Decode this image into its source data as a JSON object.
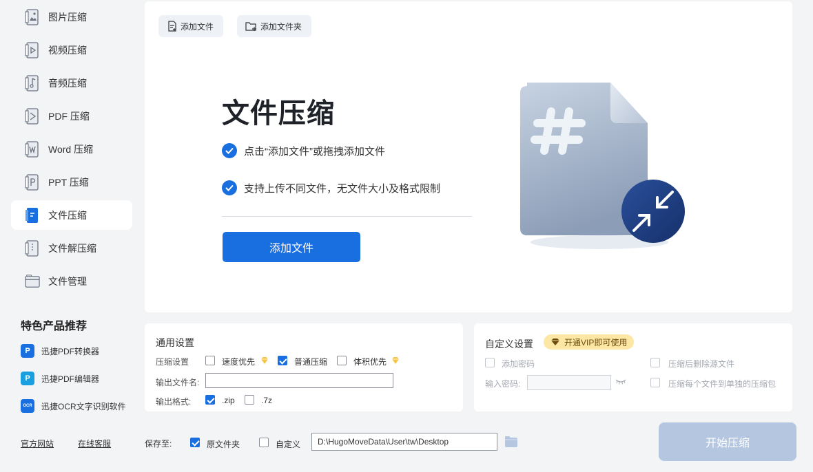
{
  "sidebar": {
    "items": [
      {
        "label": "图片压缩",
        "icon": "image-compress-icon"
      },
      {
        "label": "视频压缩",
        "icon": "video-compress-icon"
      },
      {
        "label": "音频压缩",
        "icon": "audio-compress-icon"
      },
      {
        "label": "PDF 压缩",
        "icon": "pdf-compress-icon"
      },
      {
        "label": "Word 压缩",
        "icon": "word-compress-icon"
      },
      {
        "label": "PPT 压缩",
        "icon": "ppt-compress-icon"
      },
      {
        "label": "文件压缩",
        "icon": "file-compress-icon",
        "active": true
      },
      {
        "label": "文件解压缩",
        "icon": "file-decompress-icon"
      },
      {
        "label": "文件管理",
        "icon": "file-manage-icon"
      }
    ],
    "promo_title": "特色产品推荐",
    "promos": [
      {
        "label": "迅捷PDF转换器",
        "icon": "pdf-converter-icon",
        "glyph": "P",
        "color": "#1a6fe0"
      },
      {
        "label": "迅捷PDF编辑器",
        "icon": "pdf-editor-icon",
        "glyph": "P",
        "color": "#1aa0e0"
      },
      {
        "label": "迅捷OCR文字识别软件",
        "icon": "ocr-icon",
        "glyph": "OCR",
        "color": "#1a6fe0"
      }
    ],
    "footer": {
      "website": "官方网站",
      "support": "在线客服"
    }
  },
  "main": {
    "add_file_btn": "添加文件",
    "add_folder_btn": "添加文件夹",
    "title": "文件压缩",
    "features": [
      "点击“添加文件”或拖拽添加文件",
      "支持上传不同文件，无文件大小及格式限制"
    ],
    "cta": "添加文件",
    "accent": "#1a6fe0"
  },
  "general_settings": {
    "title": "通用设置",
    "compress_label": "压缩设置",
    "options": [
      {
        "label": "速度优先",
        "checked": false,
        "vip": true
      },
      {
        "label": "普通压缩",
        "checked": true,
        "vip": false
      },
      {
        "label": "体积优先",
        "checked": false,
        "vip": true
      }
    ],
    "output_name_label": "输出文件名:",
    "output_name_value": "",
    "format_label": "输出格式:",
    "formats": [
      {
        "label": ".zip",
        "checked": true
      },
      {
        "label": ".7z",
        "checked": false
      }
    ]
  },
  "custom_settings": {
    "title": "自定义设置",
    "vip_badge": "开通VIP即可使用",
    "add_password": "添加密码",
    "password_label": "输入密码:",
    "password_value": "",
    "delete_source": "压缩后删除源文件",
    "separate_archives": "压缩每个文件到单独的压缩包"
  },
  "save": {
    "label": "保存至:",
    "original_folder": "原文件夹",
    "original_checked": true,
    "custom": "自定义",
    "custom_checked": false,
    "path": "D:\\HugoMoveData\\User\\tw\\Desktop"
  },
  "start_btn": "开始压缩"
}
